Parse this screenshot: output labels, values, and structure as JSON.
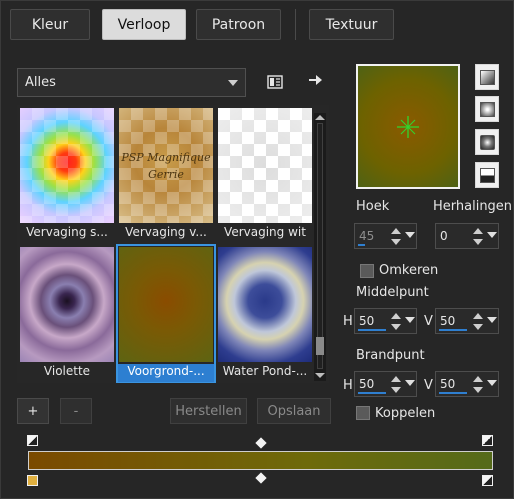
{
  "tabs": [
    "Kleur",
    "Verloop",
    "Patroon",
    "Textuur"
  ],
  "active_tab": "Verloop",
  "category": {
    "value": "Alles"
  },
  "toolbar": {
    "gallery_icon": "gallery-view-icon",
    "export_icon": "arrow-right-icon"
  },
  "gallery": {
    "items": [
      {
        "label": "Vervaging s..."
      },
      {
        "label": "Vervaging v...",
        "watermark_line1": "PSP Magnifique",
        "watermark_line2": "Gerrie"
      },
      {
        "label": "Vervaging wit"
      },
      {
        "label": "Violette"
      },
      {
        "label": "Voorgrond-...",
        "selected": true
      },
      {
        "label": "Water Pond-..."
      }
    ]
  },
  "preview": {
    "center_marker": "green-cross-icon"
  },
  "style_buttons": [
    "linear-style-icon",
    "rectangular-style-icon",
    "radial-style-icon",
    "corner-style-icon"
  ],
  "controls": {
    "hoek_label": "Hoek",
    "hoek_value": "45",
    "herhalingen_label": "Herhalingen",
    "herhalingen_value": "0",
    "omkeren_label": "Omkeren",
    "middelpunt_label": "Middelpunt",
    "middelpunt_h_label": "H",
    "middelpunt_h_value": "50",
    "middelpunt_v_label": "V",
    "middelpunt_v_value": "50",
    "brandpunt_label": "Brandpunt",
    "brandpunt_h_label": "H",
    "brandpunt_h_value": "50",
    "brandpunt_v_label": "V",
    "brandpunt_v_value": "50",
    "koppelen_label": "Koppelen"
  },
  "buttons": {
    "add": "+",
    "remove": "-",
    "restore": "Herstellen",
    "save": "Opslaan"
  },
  "gradient": {
    "colors": [
      "#7a4a00",
      "#6e6a0a",
      "#556a1a"
    ]
  }
}
